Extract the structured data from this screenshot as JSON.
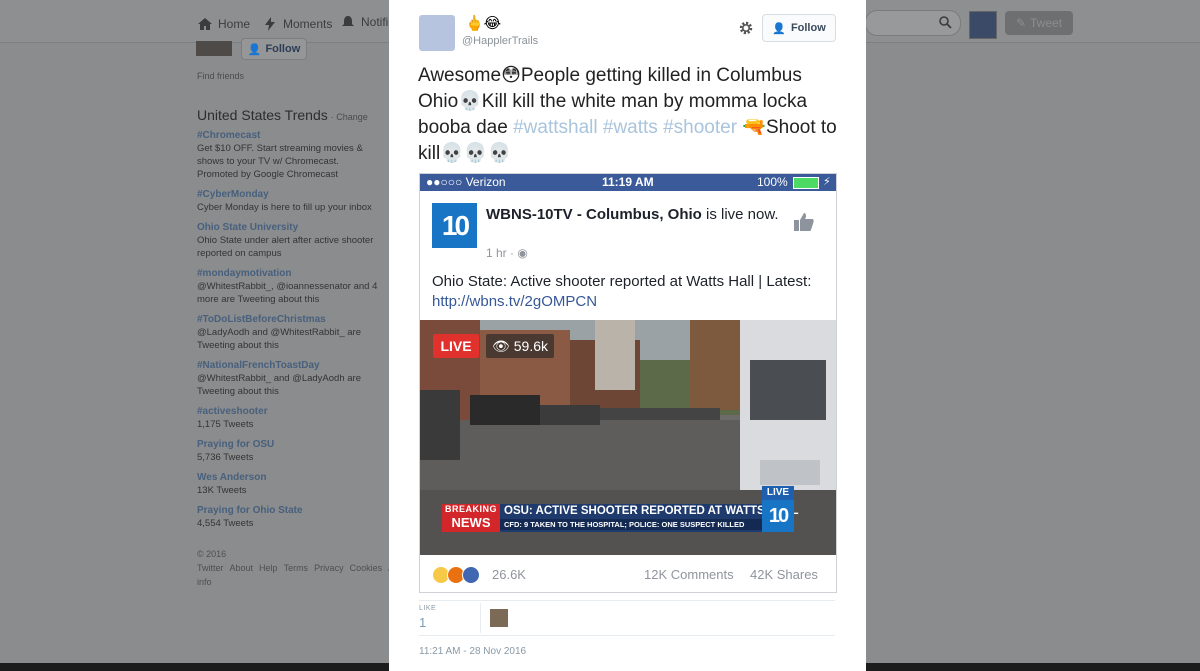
{
  "nav": {
    "home": "Home",
    "moments": "Moments",
    "notifications": "Notifica",
    "tweet_button": "Tweet"
  },
  "sidebar": {
    "follow_label": "Follow",
    "find_friends": "Find friends",
    "trends_title": "United States Trends",
    "trends_change": "· Change",
    "trends": [
      {
        "name": "#Chromecast",
        "desc": "Get $10 OFF. Start streaming movies & shows to your TV w/ Chromecast.",
        "extra": "Promoted by Google Chromecast"
      },
      {
        "name": "#CyberMonday",
        "desc": "Cyber Monday is here to fill up your inbox",
        "extra": ""
      },
      {
        "name": "Ohio State University",
        "desc": "Ohio State under alert after active shooter reported on campus",
        "extra": ""
      },
      {
        "name": "#mondaymotivation",
        "desc": "@WhitestRabbit_, @ioannessenator and 4 more are Tweeting about this",
        "extra": ""
      },
      {
        "name": "#ToDoListBeforeChristmas",
        "desc": "@LadyAodh and @WhitestRabbit_ are Tweeting about this",
        "extra": ""
      },
      {
        "name": "#NationalFrenchToastDay",
        "desc": "@WhitestRabbit_ and @LadyAodh are Tweeting about this",
        "extra": ""
      },
      {
        "name": "#activeshooter",
        "desc": "1,175 Tweets",
        "extra": ""
      },
      {
        "name": "Praying for OSU",
        "desc": "5,736 Tweets",
        "extra": ""
      },
      {
        "name": "Wes Anderson",
        "desc": "13K Tweets",
        "extra": ""
      },
      {
        "name": "Praying for Ohio State",
        "desc": "4,554 Tweets",
        "extra": ""
      }
    ],
    "footer": [
      "© 2016 Twitter",
      "About",
      "Help",
      "Terms",
      "Privacy",
      "Cookies",
      "Ads info"
    ]
  },
  "tweet": {
    "name_emoji": "🖕😂",
    "handle": "@HapplerTrails",
    "follow_label": "Follow",
    "text_parts": [
      {
        "t": "Awesome😳People getting killed in Columbus Ohio💀Kill kill the white man by momma locka booba dae ",
        "tag": false
      },
      {
        "t": "#wattshall",
        "tag": true
      },
      {
        "t": " ",
        "tag": false
      },
      {
        "t": "#watts",
        "tag": true
      },
      {
        "t": " ",
        "tag": false
      },
      {
        "t": "#shooter",
        "tag": true
      },
      {
        "t": " 🔫Shoot to kill💀💀💀",
        "tag": false
      }
    ],
    "like_label": "LIKE",
    "like_count": "1",
    "timestamp": "11:21 AM - 28 Nov 2016"
  },
  "fb": {
    "carrier": "●●○○○ Verizon",
    "time": "11:19 AM",
    "battery": "100%",
    "logo": "10",
    "page_name": "WBNS-10TV - Columbus, Ohio",
    "page_suffix": " is live now.",
    "post_time": "1 hr · ",
    "post_text": "Ohio State: Active shooter reported at Watts Hall | Latest: ",
    "post_link": "http://wbns.tv/2gOMPCN",
    "live": "LIVE",
    "viewers": "59.6k",
    "breaking_1": "BREAKING",
    "breaking_2": "NEWS",
    "ticker_1": "OSU: ACTIVE SHOOTER REPORTED AT WATTS HALL",
    "ticker_2": "CFD: 9 TAKEN TO THE HOSPITAL; POLICE: ONE SUSPECT KILLED",
    "live_badge_top": "LIVE",
    "live_badge_num": "10",
    "reactions": "26.6K",
    "comments": "12K Comments",
    "shares": "42K Shares"
  },
  "colors": {
    "hashtag": "#a9c4dc",
    "fb_blue": "#3b5a99",
    "live_red": "#e0312d"
  }
}
